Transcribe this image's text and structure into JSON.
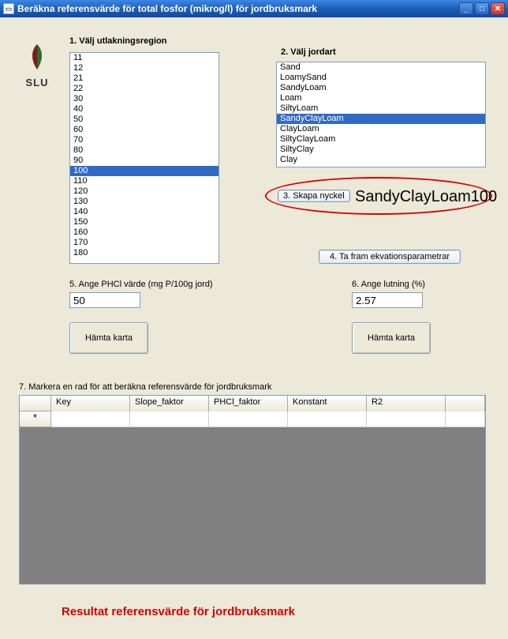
{
  "window": {
    "title": "Beräkna referensvärde för total fosfor (mikrog/l) för jordbruksmark"
  },
  "logo": {
    "text": "SLU"
  },
  "labels": {
    "region": "1. Välj utlakningsregion",
    "soil": "2. Välj jordart",
    "create_key": "3. Skapa nyckel",
    "fetch_params": "4. Ta fram ekvationsparametrar",
    "phcl": "5. Ange PHCl värde (mg P/100g jord)",
    "slope": "6. Ange lutning (%)",
    "map_btn": "Hämta karta",
    "grid": "7. Markera en rad för att beräkna referensvärde för jordbruksmark",
    "result": "Resultat referensvärde för jordbruksmark"
  },
  "region_list": [
    "11",
    "12",
    "21",
    "22",
    "30",
    "40",
    "50",
    "60",
    "70",
    "80",
    "90",
    "100",
    "110",
    "120",
    "130",
    "140",
    "150",
    "160",
    "170",
    "180"
  ],
  "region_selected_index": 11,
  "soil_list": [
    "Sand",
    "LoamySand",
    "SandyLoam",
    "Loam",
    "SiltyLoam",
    "SandyClayLoam",
    "ClayLoam",
    "SiltyClayLoam",
    "SiltyClay",
    "Clay"
  ],
  "soil_selected_index": 5,
  "key_value": "SandyClayLoam100",
  "inputs": {
    "phcl": "50",
    "slope": "2.57"
  },
  "grid_columns": [
    "Key",
    "Slope_faktor",
    "PHCl_faktor",
    "Konstant",
    "R2"
  ],
  "grid_rows": []
}
